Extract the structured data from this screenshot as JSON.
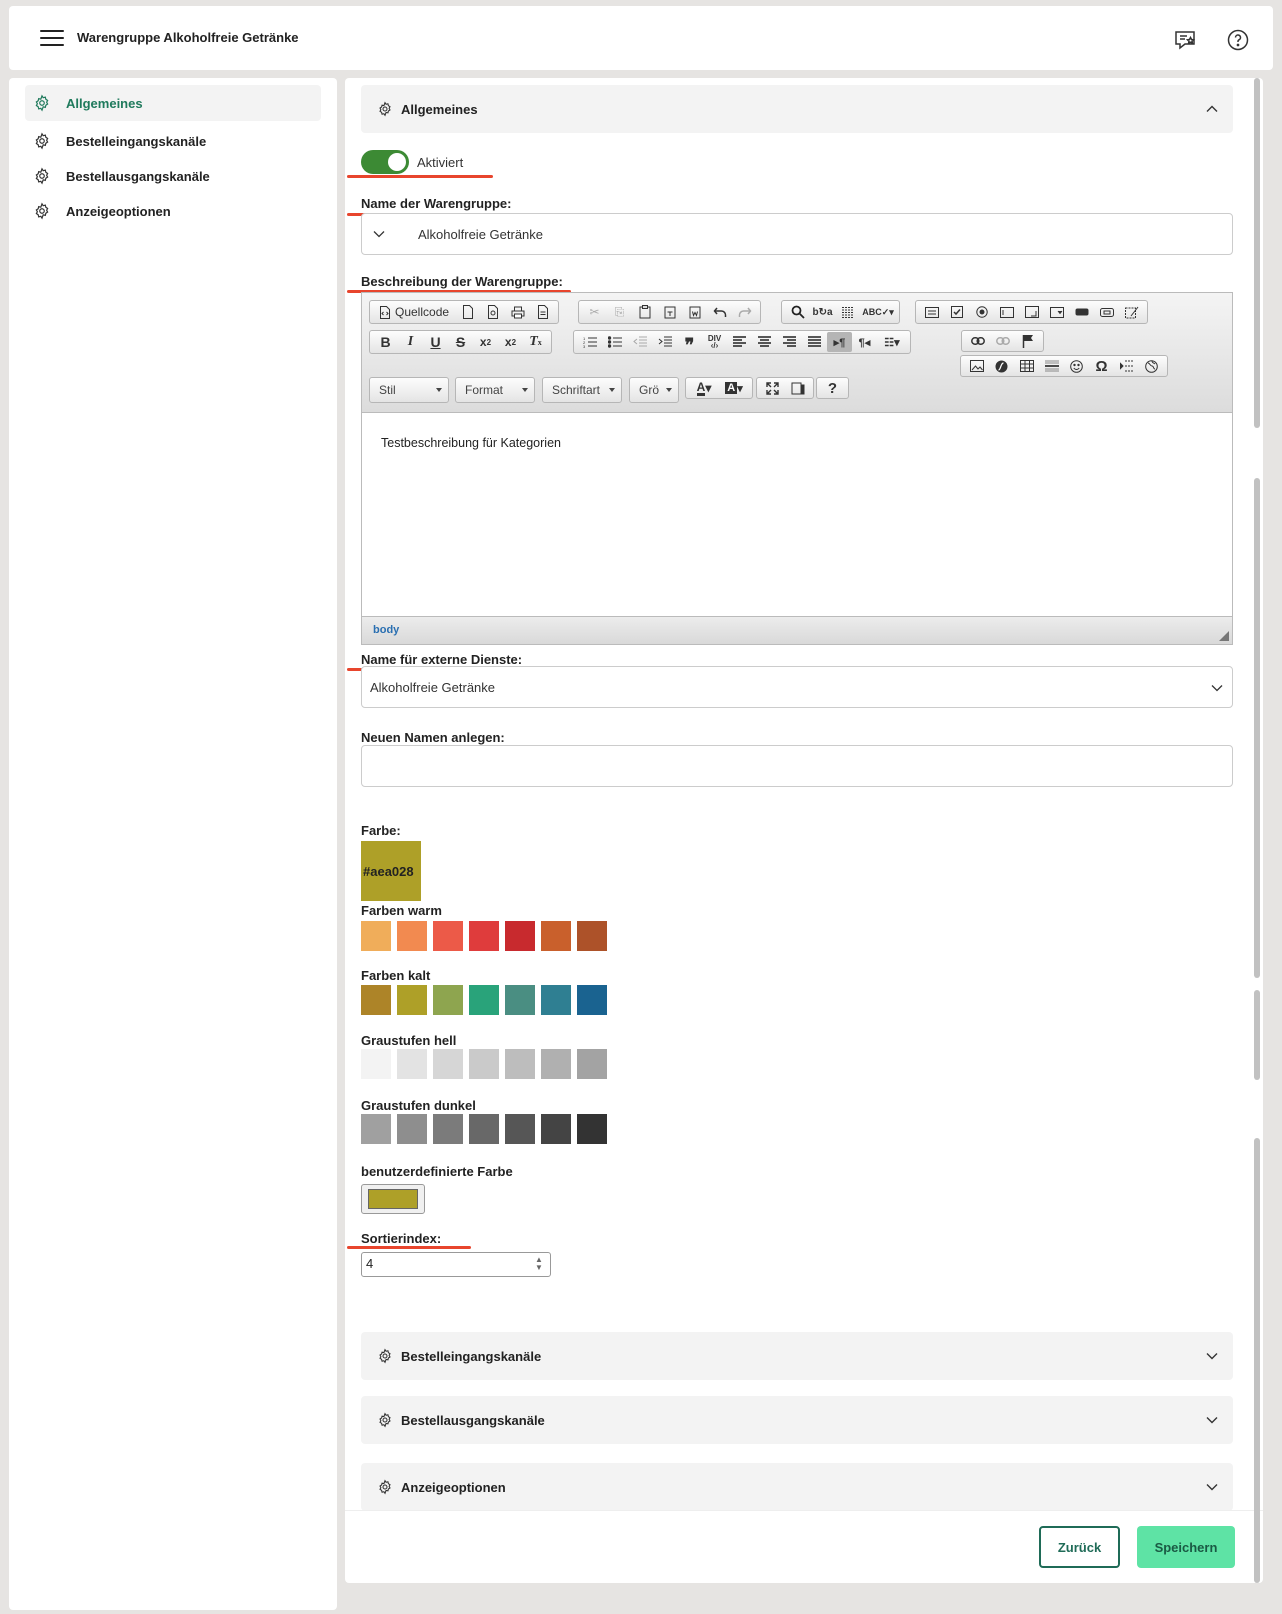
{
  "header": {
    "title": "Warengruppe Alkoholfreie Getränke",
    "menu_icon": "hamburger-icon",
    "right_icons": [
      "feedback-star-icon",
      "help-icon"
    ]
  },
  "sidebar": {
    "items": [
      {
        "label": "Allgemeines",
        "active": true
      },
      {
        "label": "Bestelleingangskanäle",
        "active": false
      },
      {
        "label": "Bestellausgangskanäle",
        "active": false
      },
      {
        "label": "Anzeigeoptionen",
        "active": false
      }
    ]
  },
  "sections": {
    "general": {
      "title": "Allgemeines",
      "expanded": true
    },
    "incoming": {
      "title": "Bestelleingangskanäle",
      "expanded": false
    },
    "outgoing": {
      "title": "Bestellausgangskanäle",
      "expanded": false
    },
    "display": {
      "title": "Anzeigeoptionen",
      "expanded": false
    }
  },
  "form": {
    "active_toggle": {
      "label": "Aktiviert",
      "on": true
    },
    "name": {
      "label": "Name der Warengruppe:",
      "value": "Alkoholfreie Getränke"
    },
    "description": {
      "label": "Beschreibung der Warengruppe:",
      "content": "Testbeschreibung für Kategorien",
      "statusbar": "body",
      "source_button": "Quellcode",
      "combos": {
        "style": "Stil",
        "format": "Format",
        "font": "Schriftart",
        "size": "Grö"
      }
    },
    "external_name": {
      "label": "Name für externe Dienste:",
      "value": "Alkoholfreie Getränke"
    },
    "new_name": {
      "label": "Neuen Namen anlegen:",
      "value": ""
    },
    "color": {
      "label": "Farbe:",
      "value": "#aea028",
      "warm_label": "Farben warm",
      "warm": [
        "#f0ad5a",
        "#f28a50",
        "#ec5a48",
        "#df3c3c",
        "#c82a2e",
        "#c9602c",
        "#ad5229"
      ],
      "cold_label": "Farben kalt",
      "cold": [
        "#ad8428",
        "#aea028",
        "#8ea54f",
        "#29a37a",
        "#4a8e82",
        "#2f7f92",
        "#1a6390"
      ],
      "light_gray_label": "Graustufen hell",
      "light_gray": [
        "#f3f3f3",
        "#e3e3e3",
        "#d6d6d6",
        "#cacaca",
        "#bdbdbd",
        "#b0b0b0",
        "#a3a3a3"
      ],
      "dark_gray_label": "Graustufen dunkel",
      "dark_gray": [
        "#a0a0a0",
        "#8e8e8e",
        "#7b7b7b",
        "#686868",
        "#565656",
        "#444444",
        "#333333"
      ],
      "custom_label": "benutzerdefinierte Farbe",
      "custom_value": "#aea028"
    },
    "sort_index": {
      "label": "Sortierindex:",
      "value": "4"
    }
  },
  "actions": {
    "back": "Zurück",
    "save": "Speichern"
  },
  "colors": {
    "accent": "#1f7a5c",
    "toggle": "#3c8a34",
    "save_bg": "#5ee3a5",
    "annotation": "#e8452d"
  }
}
